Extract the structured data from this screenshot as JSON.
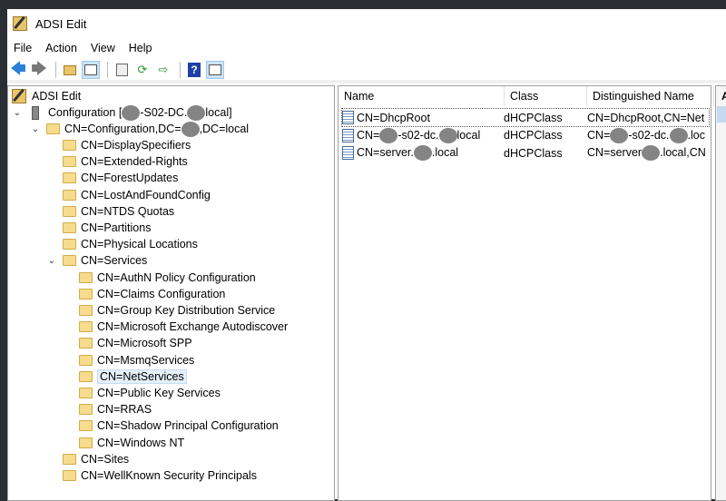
{
  "title": "ADSI Edit",
  "menu": [
    "File",
    "Action",
    "View",
    "Help"
  ],
  "toolbar": [
    "back-icon",
    "forward-icon",
    "up-folder-icon",
    "show-hide-tree-icon",
    "properties-icon",
    "refresh-icon",
    "export-list-icon",
    "help-icon",
    "show-hide-action-pane-icon"
  ],
  "tree": {
    "root": "ADSI Edit",
    "connection": {
      "a": "Configuration [",
      "b": "-S02-DC.",
      "c": "local]"
    },
    "config": {
      "a": "CN=Configuration,DC=",
      "b": ",DC=local"
    },
    "children": [
      "CN=DisplaySpecifiers",
      "CN=Extended-Rights",
      "CN=ForestUpdates",
      "CN=LostAndFoundConfig",
      "CN=NTDS Quotas",
      "CN=Partitions",
      "CN=Physical Locations"
    ],
    "services": "CN=Services",
    "service_children": [
      "CN=AuthN Policy Configuration",
      "CN=Claims Configuration",
      "CN=Group Key Distribution Service",
      "CN=Microsoft Exchange Autodiscover",
      "CN=Microsoft SPP",
      "CN=MsmqServices",
      "CN=NetServices",
      "CN=Public Key Services",
      "CN=RRAS",
      "CN=Shadow Principal Configuration",
      "CN=Windows NT"
    ],
    "tail": [
      "CN=Sites",
      "CN=WellKnown Security Principals"
    ]
  },
  "list": {
    "columns": [
      "Name",
      "Class",
      "Distinguished Name"
    ],
    "rows": [
      {
        "name": [
          "CN=DhcpRoot"
        ],
        "class": "dHCPClass",
        "dn": [
          "CN=DhcpRoot,CN=NetS"
        ]
      },
      {
        "name": [
          "CN=",
          "-s02-dc.",
          "local"
        ],
        "class": "dHCPClass",
        "dn": [
          "CN=",
          "-s02-dc.",
          ".loca"
        ]
      },
      {
        "name": [
          "CN=server.",
          ".local"
        ],
        "class": "dHCPClass",
        "dn": [
          "CN=server",
          ".local,CN="
        ]
      }
    ]
  },
  "action_header": "A"
}
